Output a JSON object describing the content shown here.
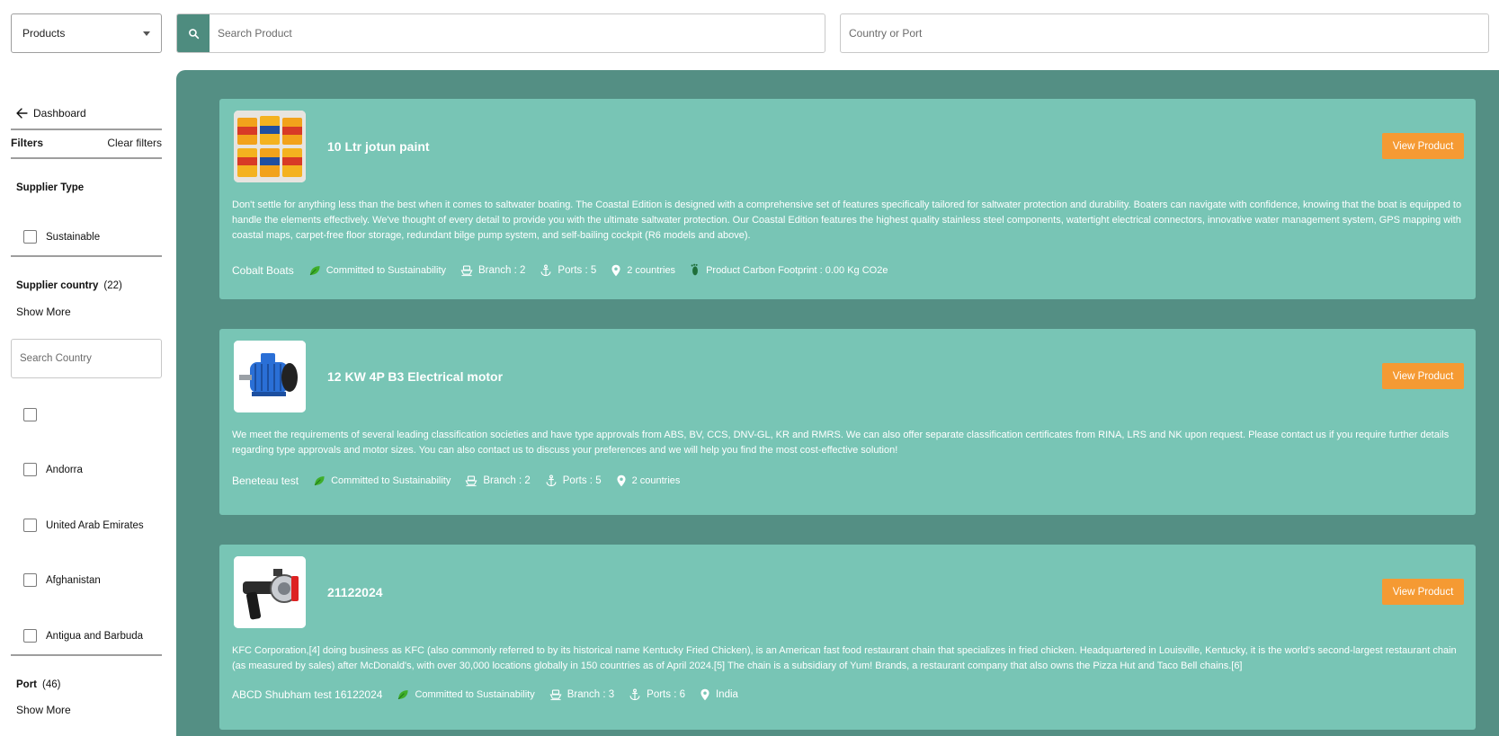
{
  "header": {
    "category_select": "Products",
    "search_placeholder": "Search Product",
    "port_placeholder": "Country or Port"
  },
  "sidebar": {
    "back_label": "Dashboard",
    "filters_label": "Filters",
    "clear_label": "Clear filters",
    "supplier_type": {
      "title": "Supplier Type",
      "options": [
        "Sustainable"
      ]
    },
    "supplier_country": {
      "title": "Supplier country",
      "count": "(22)",
      "show_more": "Show More",
      "search_placeholder": "Search Country",
      "options": [
        "",
        "Andorra",
        "United Arab Emirates",
        "Afghanistan",
        "Antigua and Barbuda"
      ]
    },
    "port": {
      "title": "Port",
      "count": "(46)",
      "show_more": "Show More"
    }
  },
  "products": [
    {
      "name": "10 Ltr jotun paint",
      "view_label": "View Product",
      "description": "Don't settle for anything less than the best when it comes to saltwater boating. The Coastal Edition is designed with a comprehensive set of features specifically tailored for saltwater protection and durability. Boaters can navigate with confidence, knowing that the boat is equipped to handle the elements effectively. We've thought of every detail to provide you with the ultimate saltwater protection. Our Coastal Edition features the highest quality stainless steel components, watertight electrical connectors, innovative water management system, GPS mapping with coastal maps, carpet-free floor storage, redundant bilge pump system, and self-bailing cockpit (R6 models and above).",
      "supplier": "Cobalt Boats",
      "sustainability": "Committed to Sustainability",
      "branch": "Branch : 2",
      "ports": "Ports : 5",
      "location": "2 countries",
      "carbon": "Product Carbon Footprint : 0.00 Kg CO2e"
    },
    {
      "name": "12 KW 4P B3 Electrical motor",
      "view_label": "View Product",
      "description": "We meet the requirements of several leading classification societies and have type approvals from ABS, BV, CCS, DNV-GL, KR and RMRS. We can also offer separate classification certificates from RINA, LRS and NK upon request. Please contact us if you require further details regarding type approvals and motor sizes. You can also contact us to discuss your preferences and we will help you find the most cost-effective solution!",
      "supplier": "Beneteau test",
      "sustainability": "Committed to Sustainability",
      "branch": "Branch : 2",
      "ports": "Ports : 5",
      "location": "2 countries"
    },
    {
      "name": "21122024",
      "view_label": "View Product",
      "description": "KFC Corporation,[4] doing business as KFC (also commonly referred to by its historical name Kentucky Fried Chicken), is an American fast food restaurant chain that specializes in fried chicken. Headquartered in Louisville, Kentucky, it is the world's second-largest restaurant chain (as measured by sales) after McDonald's, with over 30,000 locations globally in 150 countries as of April 2024.[5] The chain is a subsidiary of Yum! Brands, a restaurant company that also owns the Pizza Hut and Taco Bell chains.[6]",
      "supplier": "ABCD Shubham test 16122024",
      "sustainability": "Committed to Sustainability",
      "branch": "Branch : 3",
      "ports": "Ports : 6",
      "location": "India"
    }
  ]
}
